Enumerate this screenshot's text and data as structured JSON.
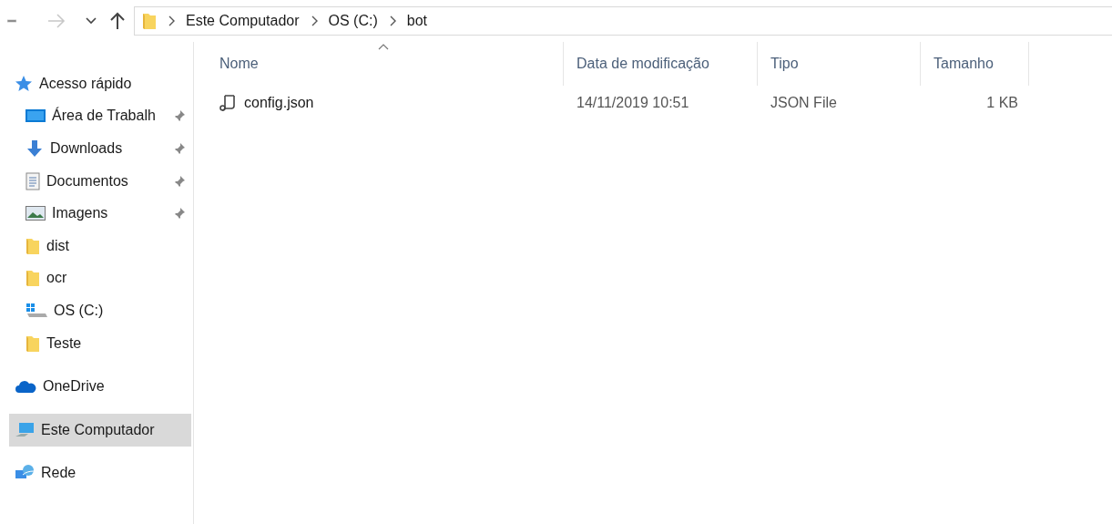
{
  "navigation": {
    "back_enabled": false,
    "forward_enabled": false
  },
  "address_bar": {
    "crumbs": [
      "Este Computador",
      "OS (C:)",
      "bot"
    ]
  },
  "sidebar": {
    "items": [
      {
        "label": "Acesso rápido",
        "kind": "star",
        "selected": false,
        "children": [
          {
            "label": "Área de Trabalh",
            "kind": "desktop",
            "pinned": true,
            "selected": false
          },
          {
            "label": "Downloads",
            "kind": "download",
            "pinned": true,
            "selected": false
          },
          {
            "label": "Documentos",
            "kind": "document",
            "pinned": true,
            "selected": false
          },
          {
            "label": "Imagens",
            "kind": "image",
            "pinned": true,
            "selected": false
          },
          {
            "label": "dist",
            "kind": "folder",
            "pinned": false,
            "selected": false
          },
          {
            "label": "ocr",
            "kind": "folder",
            "pinned": false,
            "selected": false
          },
          {
            "label": "OS (C:)",
            "kind": "drive",
            "pinned": false,
            "selected": false
          },
          {
            "label": "Teste",
            "kind": "folder",
            "pinned": false,
            "selected": false
          }
        ]
      },
      {
        "label": "OneDrive",
        "kind": "cloud",
        "selected": false
      },
      {
        "label": "Este Computador",
        "kind": "computer",
        "selected": true
      },
      {
        "label": "Rede",
        "kind": "network",
        "selected": false
      }
    ]
  },
  "table": {
    "columns": [
      {
        "label": "Nome",
        "sorted": true
      },
      {
        "label": "Data de modificação",
        "sorted": false
      },
      {
        "label": "Tipo",
        "sorted": false
      },
      {
        "label": "Tamanho",
        "sorted": false
      }
    ],
    "rows": [
      {
        "name": "config.json",
        "modified": "14/11/2019 10:51",
        "type": "JSON File",
        "size": "1 KB"
      }
    ]
  }
}
